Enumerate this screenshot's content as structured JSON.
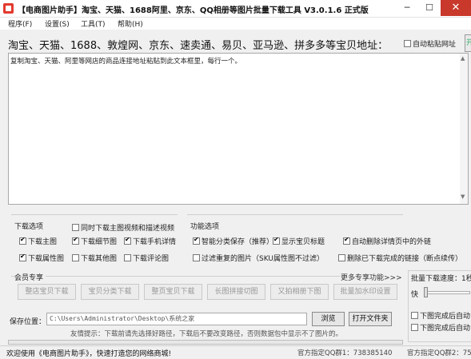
{
  "window": {
    "title": "【电商图片助手】淘宝、天猫、1688阿里、京东、QQ相册等图片批量下载工具 V3.0.1.6 正式版",
    "min_glyph": "─",
    "max_glyph": "☐",
    "close_glyph": "✕"
  },
  "menu": [
    "程序(F)",
    "设置(S)",
    "工具(T)",
    "帮助(H)"
  ],
  "header": {
    "label": "淘宝、天猫、1688、敦煌网、京东、速卖通、易贝、亚马逊、拼多多等宝贝地址：",
    "auto_paste_label": "自动粘贴网址",
    "side_button_label": "开"
  },
  "url_box": {
    "placeholder_text": "复制淘宝、天猫、阿里等网店的商品连接地址粘贴到此文本框里，每行一个。"
  },
  "download_options": {
    "title": "下载选项",
    "video_option": {
      "label": "同时下载主图视频和描述视频",
      "checked": false
    },
    "items": [
      {
        "label": "下载主图",
        "checked": true
      },
      {
        "label": "下载细节图",
        "checked": true
      },
      {
        "label": "下载手机详情",
        "checked": true
      },
      {
        "label": "下载属性图",
        "checked": true
      },
      {
        "label": "下载其他图",
        "checked": false
      },
      {
        "label": "下载评论图",
        "checked": false
      }
    ]
  },
  "function_options": {
    "title": "功能选项",
    "items": [
      {
        "label": "智能分类保存（推荐）",
        "checked": true
      },
      {
        "label": "显示宝贝标题",
        "checked": true
      },
      {
        "label": "自动删除详情页中的外链",
        "checked": true
      },
      {
        "label": "过滤重复的图片（SKU属性图不过滤）",
        "checked": false
      },
      {
        "label": "删除已下载完成的链接（断点续传）",
        "checked": false
      }
    ]
  },
  "vip": {
    "title": "会员专享",
    "more_link": "更多专享功能>>>",
    "buttons": [
      "整店宝贝下载",
      "宝贝分类下载",
      "整页宝贝下载",
      "长图拼接切图",
      "又拍相册下图",
      "批量加水印设置"
    ]
  },
  "batch": {
    "speed_label": "批量下载速度：1秒",
    "speed_value_label": "快",
    "after_options": [
      {
        "label": "下图完成后自动",
        "checked": false
      },
      {
        "label": "下图完成后自动",
        "checked": false
      }
    ]
  },
  "save": {
    "label": "保存位置：",
    "path": "C:\\Users\\Administrator\\Desktop\\系统之家",
    "browse_label": "浏览",
    "open_folder_label": "打开文件夹",
    "tip": "友情提示：下载前请先选择好路径，下载后不要改变路径，否则数据包中显示不了图片的。"
  },
  "status": {
    "welcome": "欢迎使用《电商图片助手》，快速打造您的网络商城!",
    "qq_group_1": "官方指定QQ群1：738385140",
    "qq_group_2": "官方指定QQ群2：75"
  },
  "colors": {
    "close_button": "#c8382b",
    "app_icon": "#e23a2e",
    "accent_text": "#3a6"
  }
}
